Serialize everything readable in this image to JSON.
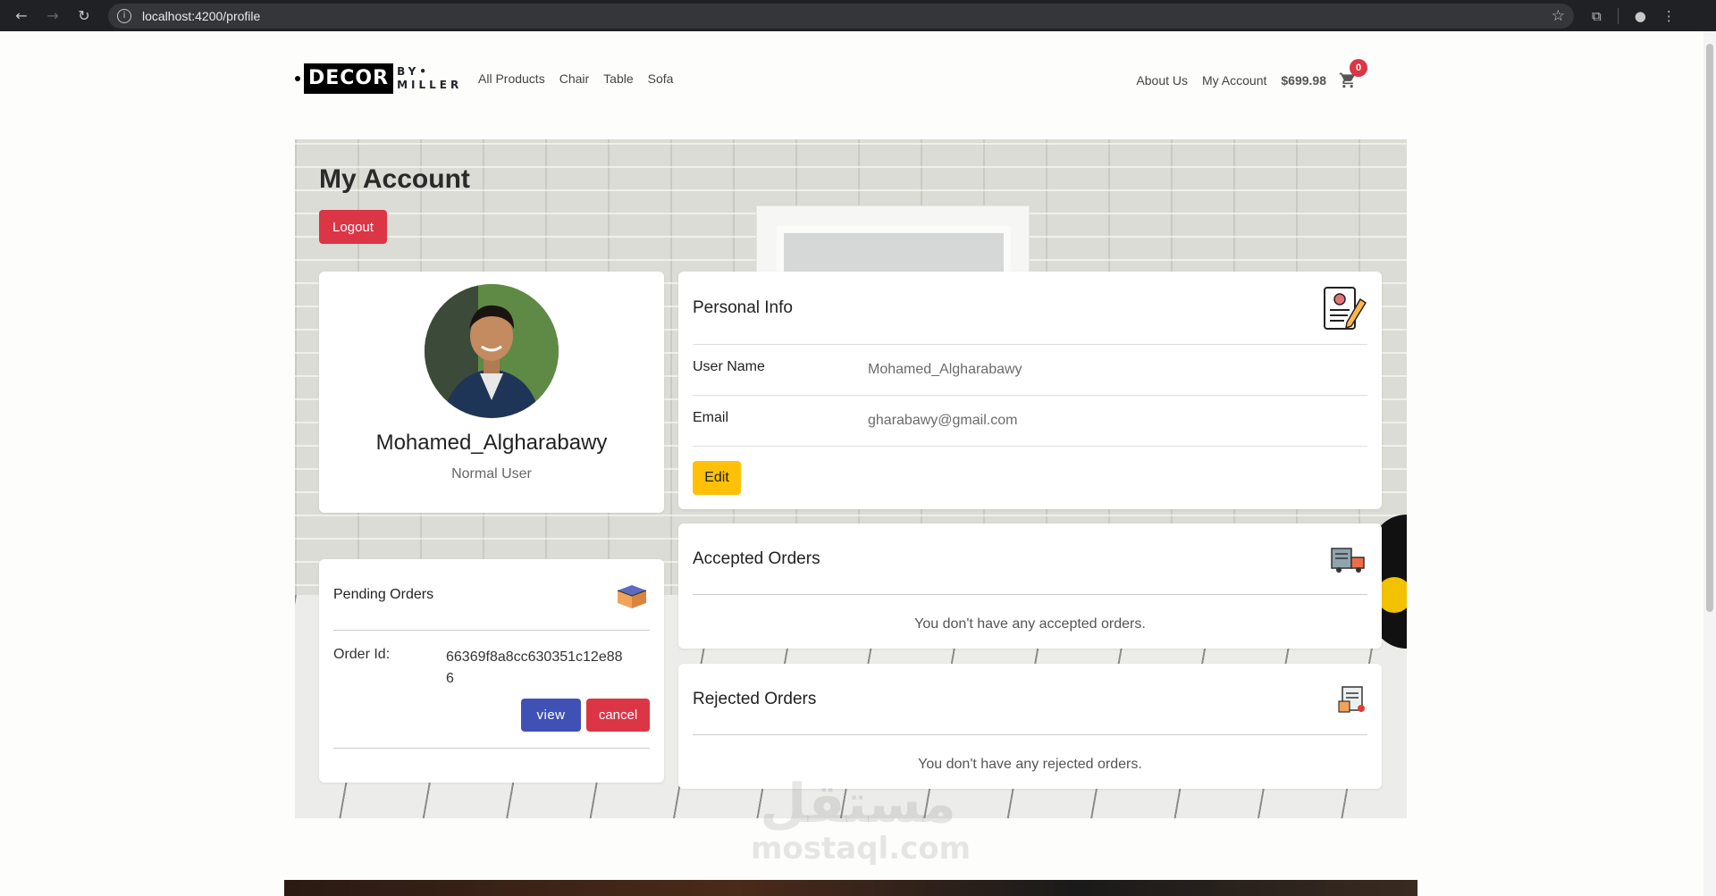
{
  "browser": {
    "url": "localhost:4200/profile"
  },
  "header": {
    "logo": {
      "main": "DECOR",
      "by": "BY",
      "sub": "MILLER"
    },
    "nav_left": [
      "All Products",
      "Chair",
      "Table",
      "Sofa"
    ],
    "nav_right": {
      "about": "About Us",
      "account": "My Account",
      "total": "$699.98",
      "cart_count": "0"
    }
  },
  "page": {
    "title": "My Account",
    "logout_label": "Logout"
  },
  "profile": {
    "name": "Mohamed_Algharabawy",
    "role": "Normal User"
  },
  "personal_info": {
    "title": "Personal Info",
    "username_label": "User Name",
    "username_value": "Mohamed_Algharabawy",
    "email_label": "Email",
    "email_value": "gharabawy@gmail.com",
    "edit_label": "Edit"
  },
  "pending": {
    "title": "Pending Orders",
    "order_label": "Order Id:",
    "order_id": "66369f8a8cc630351c12e886",
    "view_label": "view",
    "cancel_label": "cancel"
  },
  "accepted": {
    "title": "Accepted Orders",
    "empty": "You don't have any accepted orders."
  },
  "rejected": {
    "title": "Rejected Orders",
    "empty": "You don't have any rejected orders."
  },
  "watermark": {
    "ar": "مستقل",
    "en": "mostaql.com"
  },
  "colors": {
    "danger": "#dc3545",
    "warning": "#ffc107",
    "primary": "#3f51b5"
  }
}
